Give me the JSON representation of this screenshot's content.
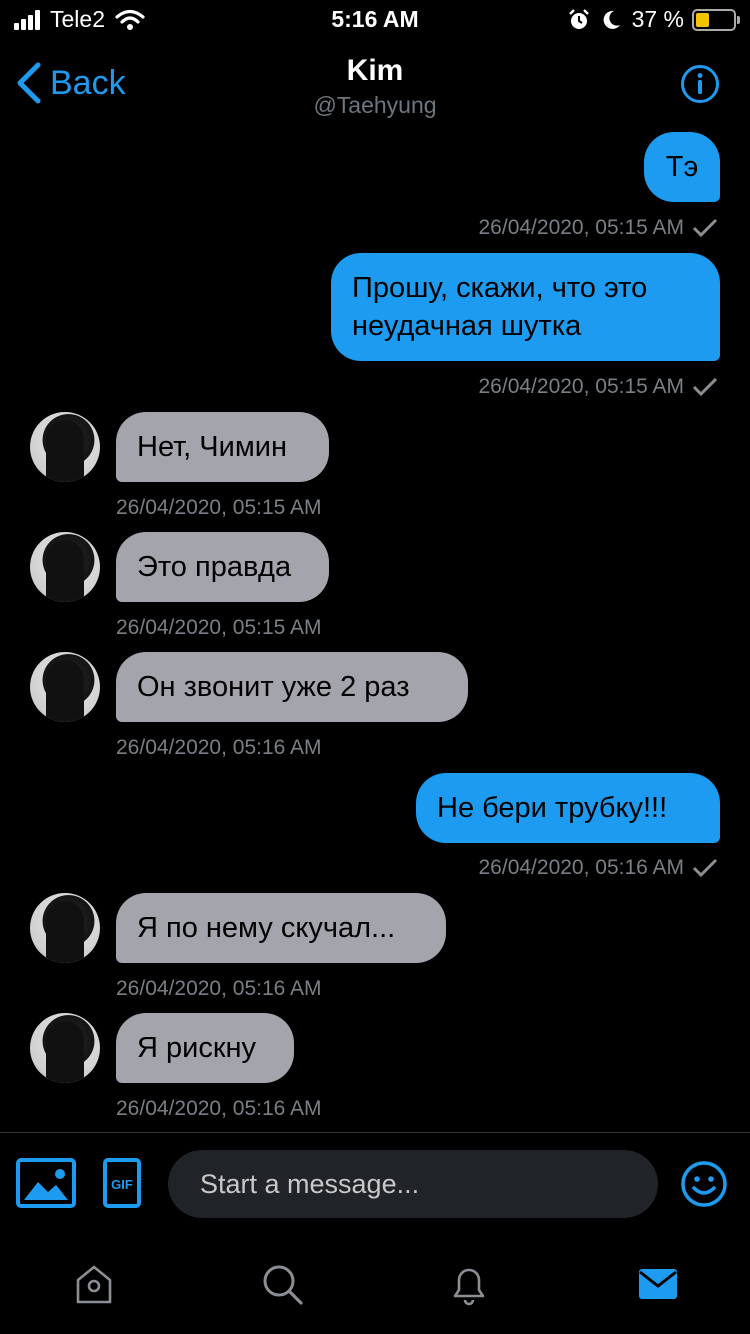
{
  "status_bar": {
    "carrier": "Tele2",
    "time": "5:16 AM",
    "battery_percent": "37 %",
    "battery_level": 0.37
  },
  "header": {
    "back_label": "Back",
    "title": "Kim",
    "handle": "@Taehyung"
  },
  "messages": [
    {
      "direction": "out",
      "text": "Тэ",
      "timestamp": "26/04/2020, 05:15 AM",
      "read": true
    },
    {
      "direction": "out",
      "text": "Прошу, скажи, что это неудачная шутка",
      "line1": "Прошу, скажи, что это",
      "line2": "неудачная шутка",
      "timestamp": "26/04/2020, 05:15 AM",
      "read": true
    },
    {
      "direction": "in",
      "text": "Нет, Чимин",
      "timestamp": "26/04/2020, 05:15 AM"
    },
    {
      "direction": "in",
      "text": "Это правда",
      "timestamp": "26/04/2020, 05:15 AM"
    },
    {
      "direction": "in",
      "text": "Он звонит уже 2 раз",
      "timestamp": "26/04/2020, 05:16 AM"
    },
    {
      "direction": "out",
      "text": "Не бери трубку!!!",
      "timestamp": "26/04/2020, 05:16 AM",
      "read": true
    },
    {
      "direction": "in",
      "text": "Я по нему скучал...",
      "timestamp": "26/04/2020, 05:16 AM"
    },
    {
      "direction": "in",
      "text": "Я рискну",
      "timestamp": "26/04/2020, 05:16 AM"
    }
  ],
  "composer": {
    "placeholder": "Start a message...",
    "gif_label": "GIF"
  },
  "tab_bar": {
    "items": [
      "home-icon",
      "search-icon",
      "notifications-icon",
      "messages-icon"
    ],
    "active": "messages-icon"
  },
  "colors": {
    "accent": "#1d9bf0",
    "incoming_bubble": "#a4a4ac",
    "background": "#000000",
    "timestamp": "#7a7f85"
  }
}
